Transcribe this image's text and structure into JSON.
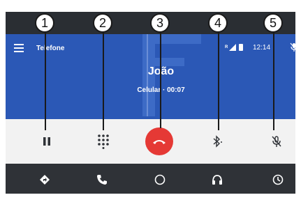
{
  "header": {
    "title": "Telefone",
    "network_label": "R",
    "clock": "12:14"
  },
  "call": {
    "caller_name": "João",
    "status": "Celular · 00:07"
  },
  "controls": [
    {
      "name": "pause",
      "icon": "pause-icon"
    },
    {
      "name": "keypad",
      "icon": "dialpad-icon"
    },
    {
      "name": "end-call",
      "icon": "hang-up-icon",
      "color": "#e53935"
    },
    {
      "name": "bluetooth",
      "icon": "bluetooth-icon"
    },
    {
      "name": "mute",
      "icon": "mic-off-icon"
    }
  ],
  "navbar": [
    {
      "name": "maps",
      "icon": "navigation-icon"
    },
    {
      "name": "phone",
      "icon": "phone-icon"
    },
    {
      "name": "home",
      "icon": "home-circle-icon"
    },
    {
      "name": "audio",
      "icon": "headphones-icon"
    },
    {
      "name": "exit",
      "icon": "exit-icon"
    }
  ],
  "callouts": [
    "1",
    "2",
    "3",
    "4",
    "5"
  ],
  "colors": {
    "screen_bg": "#2b58b6",
    "control_bar": "#f2f2f2",
    "navbar": "#2f3237",
    "end_call": "#e53935"
  }
}
